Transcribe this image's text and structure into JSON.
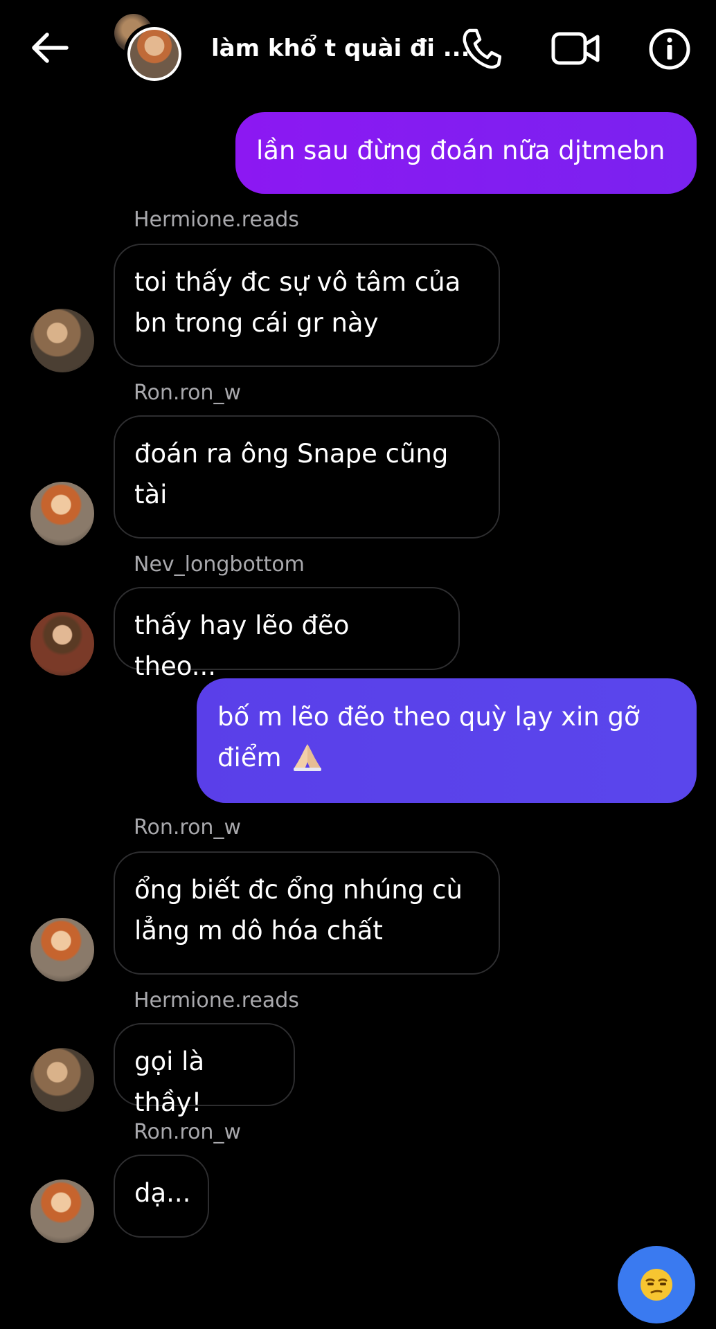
{
  "header": {
    "title": "làm khổ t quài đi ...",
    "icons": [
      "back-arrow-icon",
      "group-avatar",
      "phone-icon",
      "video-camera-icon",
      "info-icon"
    ]
  },
  "messages": [
    {
      "type": "outgoing",
      "text": "lần sau đừng đoán nữa djtmebn"
    },
    {
      "type": "incoming",
      "sender": "Hermione.reads",
      "text": "toi thấy đc sự vô tâm của bn trong cái gr này"
    },
    {
      "type": "incoming",
      "sender": "Ron.ron_w",
      "text": "đoán ra ông Snape cũng tài"
    },
    {
      "type": "incoming",
      "sender": "Nev_longbottom",
      "text": "thấy hay lẽo đẽo theo..."
    },
    {
      "type": "outgoing",
      "text": "bố m lẽo đẽo theo quỳ lạy xin gỡ điểm",
      "emoji": "folded-hands"
    },
    {
      "type": "incoming",
      "sender": "Ron.ron_w",
      "text": "ổng biết đc ổng nhúng cù lẳng m dô hóa chất"
    },
    {
      "type": "incoming",
      "sender": "Hermione.reads",
      "text": "gọi là thầy!"
    },
    {
      "type": "incoming",
      "sender": "Ron.ron_w",
      "text": "dạ..."
    }
  ],
  "quick_reaction": {
    "emoji": "unamused-face"
  },
  "colors": {
    "background": "#000000",
    "outgoing_1": "#8a1cf2",
    "outgoing_2": "#5a46ec",
    "incoming_border": "#2e2e30",
    "sender_name": "#a9a9ad",
    "fab": "#3a7af0"
  }
}
